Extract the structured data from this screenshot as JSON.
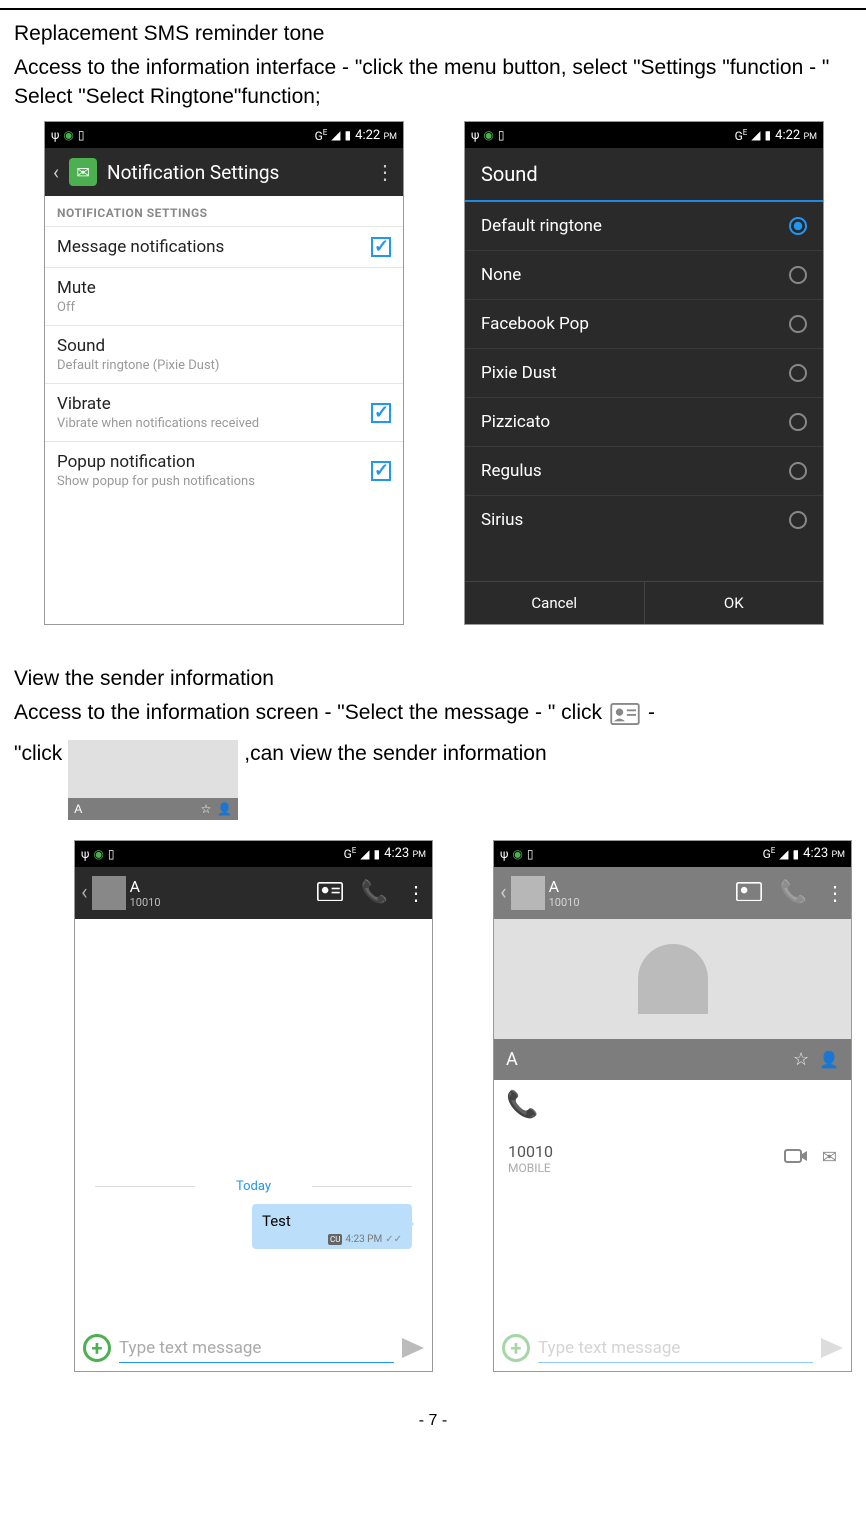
{
  "doc": {
    "h1": "Replacement SMS reminder tone",
    "p1": "Access to the information interface - \"click the menu button, select \"Settings \"function - \" Select \"Select Ringtone\"function;",
    "h2": "View the sender information",
    "p2a": "Access to the information screen - \"Select the message - \" click",
    "p2b": "-",
    "p3a": "\"click",
    "p3b": ",can view the sender information",
    "footer": "- 7 -",
    "inline_chip_name": "A"
  },
  "status": {
    "time1": "4:22",
    "time2": "4:23",
    "pm": "PM",
    "g": "G",
    "e": "E"
  },
  "screen1": {
    "title": "Notification Settings",
    "section": "NOTIFICATION SETTINGS",
    "rows": [
      {
        "t1": "Message notifications",
        "t2": "",
        "checked": true
      },
      {
        "t1": "Mute",
        "t2": "Off",
        "checked": null
      },
      {
        "t1": "Sound",
        "t2": "Default ringtone (Pixie Dust)",
        "checked": null
      },
      {
        "t1": "Vibrate",
        "t2": "Vibrate when notifications received",
        "checked": true
      },
      {
        "t1": "Popup notification",
        "t2": "Show popup for push notifications",
        "checked": true
      }
    ]
  },
  "screen2": {
    "title": "Sound",
    "items": [
      {
        "label": "Default ringtone",
        "selected": true
      },
      {
        "label": "None",
        "selected": false
      },
      {
        "label": "Facebook Pop",
        "selected": false
      },
      {
        "label": "Pixie Dust",
        "selected": false
      },
      {
        "label": "Pizzicato",
        "selected": false
      },
      {
        "label": "Regulus",
        "selected": false
      },
      {
        "label": "Sirius",
        "selected": false
      }
    ],
    "cancel": "Cancel",
    "ok": "OK"
  },
  "screen3": {
    "name": "A",
    "number": "10010",
    "today": "Today",
    "bubble_text": "Test",
    "bubble_time": "4:23 PM",
    "bubble_badge": "CU",
    "compose_placeholder": "Type text message"
  },
  "screen4": {
    "name": "A",
    "number": "10010",
    "popup_name": "A",
    "popup_number": "10010",
    "popup_label": "MOBILE",
    "compose_placeholder": "Type text message"
  }
}
